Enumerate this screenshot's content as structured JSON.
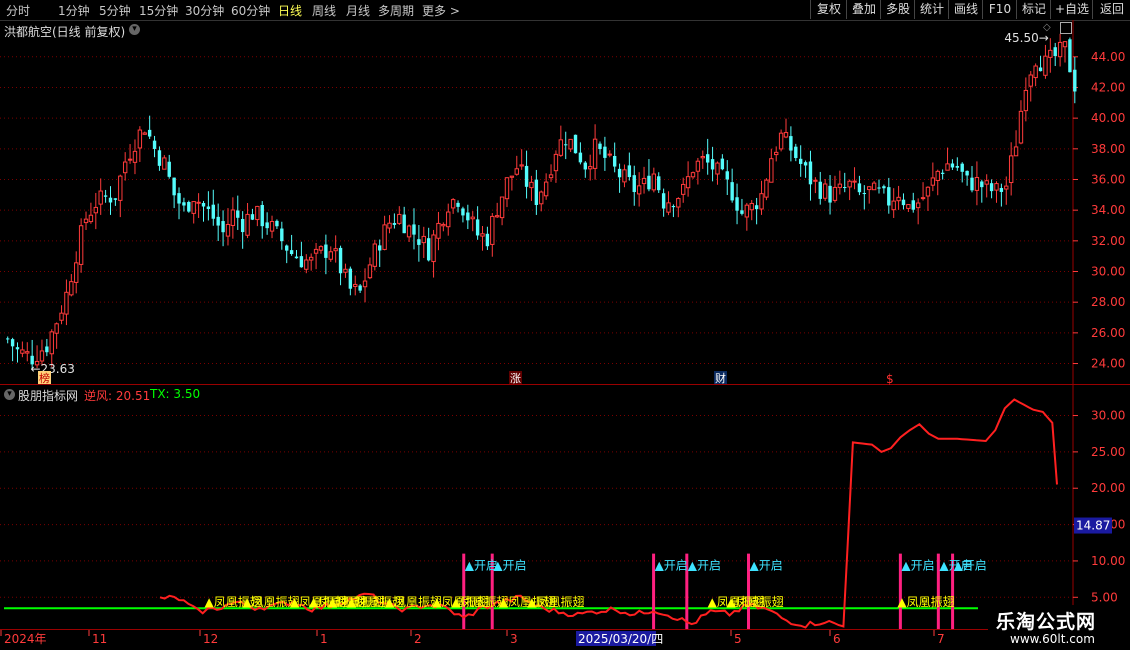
{
  "toolbar": {
    "periods": [
      "分时",
      "1分钟",
      "5分钟",
      "15分钟",
      "30分钟",
      "60分钟",
      "日线",
      "周线",
      "月线",
      "多周期",
      "更多"
    ],
    "active_period": "日线",
    "more_arrow": ">",
    "right_buttons": [
      "复权",
      "叠加",
      "多股",
      "统计",
      "画线",
      "F10",
      "标记",
      "+自选",
      "返回"
    ]
  },
  "main_panel": {
    "title": "洪都航空(日线 前复权)",
    "high_label": "45.50",
    "low_label": "23.63",
    "markers": [
      "榜",
      "涨",
      "财",
      "$"
    ]
  },
  "indicator_panel": {
    "title": "股朋指标网",
    "line1_label": "逆风: 20.51",
    "line2_label": "TX: 3.50",
    "current_value": "14.87",
    "signal_open": "开启",
    "signal_phoenix": "凤凰振翅"
  },
  "date_axis": {
    "labels": [
      "2024年",
      "11",
      "12",
      "1",
      "2",
      "3",
      "2025/03/20/四",
      "5",
      "6",
      "7"
    ],
    "selected": "2025/03/20/四"
  },
  "watermark": {
    "title": "乐淘公式网",
    "url": "www.60lt.com"
  },
  "colors": {
    "up": "#ff3b3b",
    "down": "#54fcfc",
    "indicator_line": "#ff2020",
    "baseline": "#00ff00",
    "signal_open": "#3ee3ff",
    "signal_phoenix": "#ffff00",
    "signal_bar": "#ff2080",
    "grid": "#7a0000",
    "axis_text": "#ff3b3b"
  },
  "chart_data": [
    {
      "type": "candlestick",
      "title": "洪都航空(日线 前复权)",
      "y_axis": [
        24.0,
        26.0,
        28.0,
        30.0,
        32.0,
        34.0,
        36.0,
        38.0,
        40.0,
        42.0,
        44.0
      ],
      "ylim": [
        22.6,
        46.4
      ],
      "high": 45.5,
      "low": 23.63,
      "series": [
        {
          "name": "price",
          "anchors": [
            [
              0,
              25.6
            ],
            [
              2,
              24.8
            ],
            [
              5,
              24.4
            ],
            [
              8,
              25.2
            ],
            [
              10,
              26.8
            ],
            [
              12,
              28.5
            ],
            [
              14,
              31.2
            ],
            [
              16,
              33.5
            ],
            [
              18,
              34.5
            ],
            [
              20,
              34.8
            ],
            [
              22,
              35.0
            ],
            [
              24,
              37.2
            ],
            [
              26,
              38.5
            ],
            [
              28,
              39.5
            ],
            [
              30,
              38.0
            ],
            [
              32,
              37.0
            ],
            [
              34,
              35.0
            ],
            [
              36,
              34.0
            ],
            [
              38,
              35.0
            ],
            [
              40,
              34.2
            ],
            [
              42,
              33.5
            ],
            [
              44,
              32.5
            ],
            [
              46,
              33.8
            ],
            [
              48,
              33.2
            ],
            [
              50,
              33.8
            ],
            [
              52,
              33.4
            ],
            [
              54,
              32.8
            ],
            [
              56,
              32.0
            ],
            [
              58,
              31.2
            ],
            [
              60,
              30.8
            ],
            [
              62,
              30.6
            ],
            [
              64,
              31.2
            ],
            [
              66,
              31.6
            ],
            [
              68,
              30.2
            ],
            [
              70,
              28.8
            ],
            [
              72,
              28.6
            ],
            [
              74,
              30.5
            ],
            [
              76,
              32.0
            ],
            [
              78,
              33.2
            ],
            [
              80,
              33.6
            ],
            [
              82,
              32.8
            ],
            [
              84,
              32.2
            ],
            [
              86,
              31.4
            ],
            [
              88,
              33.0
            ],
            [
              90,
              34.5
            ],
            [
              92,
              34.8
            ],
            [
              94,
              33.6
            ],
            [
              96,
              32.4
            ],
            [
              98,
              32.2
            ],
            [
              100,
              34.2
            ],
            [
              102,
              35.8
            ],
            [
              104,
              36.8
            ],
            [
              106,
              35.8
            ],
            [
              108,
              34.8
            ],
            [
              110,
              36.0
            ],
            [
              112,
              38.0
            ],
            [
              114,
              38.8
            ],
            [
              116,
              38.0
            ],
            [
              118,
              37.0
            ],
            [
              120,
              38.0
            ],
            [
              122,
              37.4
            ],
            [
              124,
              36.6
            ],
            [
              126,
              36.0
            ],
            [
              128,
              35.4
            ],
            [
              130,
              35.6
            ],
            [
              132,
              36.4
            ],
            [
              134,
              34.6
            ],
            [
              136,
              34.8
            ],
            [
              138,
              35.2
            ],
            [
              140,
              36.8
            ],
            [
              142,
              37.2
            ],
            [
              144,
              36.8
            ],
            [
              146,
              36.0
            ],
            [
              148,
              35.2
            ],
            [
              150,
              33.8
            ],
            [
              152,
              34.2
            ],
            [
              154,
              35.0
            ],
            [
              156,
              37.5
            ],
            [
              158,
              38.8
            ],
            [
              160,
              38.0
            ],
            [
              162,
              37.0
            ],
            [
              164,
              36.0
            ],
            [
              166,
              35.4
            ],
            [
              168,
              35.0
            ],
            [
              170,
              35.2
            ],
            [
              172,
              35.6
            ],
            [
              174,
              35.0
            ],
            [
              176,
              35.2
            ],
            [
              178,
              35.0
            ],
            [
              180,
              34.6
            ],
            [
              182,
              35.2
            ],
            [
              184,
              34.2
            ],
            [
              186,
              34.5
            ],
            [
              188,
              35.2
            ],
            [
              190,
              36.5
            ],
            [
              192,
              37.0
            ],
            [
              194,
              36.8
            ],
            [
              196,
              35.8
            ],
            [
              198,
              35.8
            ],
            [
              200,
              35.4
            ],
            [
              202,
              35.2
            ],
            [
              204,
              35.6
            ],
            [
              206,
              38.5
            ],
            [
              208,
              42.5
            ],
            [
              210,
              44.0
            ],
            [
              212,
              43.5
            ],
            [
              214,
              44.0
            ],
            [
              216,
              44.5
            ],
            [
              218,
              42.2
            ]
          ]
        }
      ]
    },
    {
      "type": "line",
      "title": "股朋指标网",
      "y_axis": [
        5.0,
        10.0,
        15.0,
        20.0,
        25.0,
        30.0
      ],
      "ylim": [
        0.5,
        34.2
      ],
      "series": [
        {
          "name": "逆风",
          "values_anchors": [
            [
              0,
              5.0
            ],
            [
              4,
              4.8
            ],
            [
              8,
              3.0
            ],
            [
              12,
              3.5
            ],
            [
              16,
              4.3
            ],
            [
              20,
              3.6
            ],
            [
              24,
              3.8
            ],
            [
              28,
              4.4
            ],
            [
              32,
              3.4
            ],
            [
              36,
              3.9
            ],
            [
              40,
              4.7
            ],
            [
              44,
              5.4
            ],
            [
              48,
              3.8
            ],
            [
              52,
              3.3
            ],
            [
              56,
              4.0
            ],
            [
              60,
              3.6
            ],
            [
              64,
              2.1
            ],
            [
              68,
              3.6
            ],
            [
              72,
              4.3
            ],
            [
              76,
              5.0
            ],
            [
              80,
              3.6
            ],
            [
              84,
              3.0
            ],
            [
              88,
              2.6
            ],
            [
              92,
              3.1
            ],
            [
              96,
              3.4
            ],
            [
              100,
              2.6
            ],
            [
              104,
              3.3
            ],
            [
              108,
              2.4
            ],
            [
              112,
              1.3
            ],
            [
              116,
              3.0
            ],
            [
              120,
              2.7
            ],
            [
              124,
              3.9
            ],
            [
              128,
              3.3
            ],
            [
              132,
              1.8
            ],
            [
              136,
              1.2
            ],
            [
              140,
              1.7
            ],
            [
              144,
              1.0
            ],
            [
              146,
              26.3
            ],
            [
              150,
              26.0
            ],
            [
              152,
              25.0
            ],
            [
              154,
              25.5
            ],
            [
              156,
              27.0
            ],
            [
              158,
              28.0
            ],
            [
              160,
              28.8
            ],
            [
              162,
              27.5
            ],
            [
              164,
              26.8
            ],
            [
              168,
              26.8
            ],
            [
              172,
              26.6
            ],
            [
              174,
              26.5
            ],
            [
              176,
              28.0
            ],
            [
              178,
              31.0
            ],
            [
              180,
              32.2
            ],
            [
              182,
              31.5
            ],
            [
              184,
              30.8
            ],
            [
              186,
              30.5
            ],
            [
              188,
              29.0
            ],
            [
              189,
              20.51
            ]
          ]
        },
        {
          "name": "TX",
          "values_anchors": [
            [
              0,
              3.5
            ],
            [
              189,
              3.5
            ]
          ]
        }
      ],
      "open_signals_x": [
        64,
        70,
        104,
        111,
        124,
        156,
        164,
        167
      ],
      "phoenix_signals_x": [
        2,
        10,
        20,
        24,
        28,
        32,
        40,
        50,
        54,
        64,
        70,
        108,
        112,
        148
      ]
    }
  ]
}
